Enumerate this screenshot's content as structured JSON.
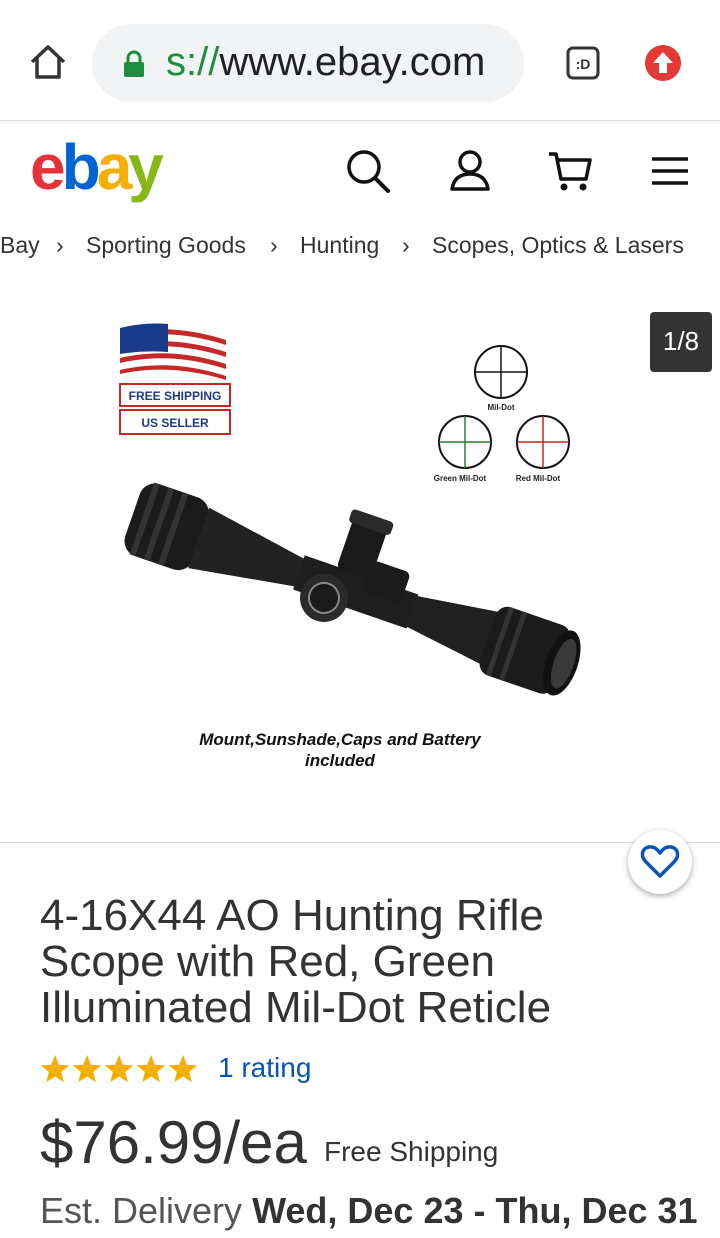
{
  "browser": {
    "url_prefix": "s://",
    "url_host": "www.ebay.com",
    "tabs_badge": ":D"
  },
  "header": {
    "logo_letters": [
      "e",
      "b",
      "a",
      "y"
    ],
    "logo_colors": [
      "#e53238",
      "#0064d2",
      "#f5af02",
      "#86b817"
    ]
  },
  "breadcrumb": [
    "Bay",
    "Sporting Goods",
    "Hunting",
    "Scopes, Optics & Lasers"
  ],
  "gallery": {
    "counter": "1/8",
    "badge_line1": "FREE SHIPPING",
    "badge_line2": "US SELLER",
    "reticle_top": "Mil-Dot",
    "reticle_left": "Green Mil-Dot",
    "reticle_right": "Red Mil-Dot",
    "caption_line1": "Mount,Sunshade,Caps and Battery",
    "caption_line2": "included"
  },
  "product": {
    "title": "4-16X44 AO  Hunting Rifle Scope with Red, Green Illuminated Mil-Dot Reticle",
    "rating_stars": 5,
    "rating_text": "1 rating",
    "price": "$76.99/ea",
    "shipping": "Free Shipping",
    "delivery_label": "Est. Delivery",
    "delivery_dates": "Wed, Dec 23 - Thu, Dec 31"
  },
  "colors": {
    "link": "#0654ba",
    "star": "#f5af02",
    "lock": "#1e8e3e",
    "update": "#e53935"
  }
}
